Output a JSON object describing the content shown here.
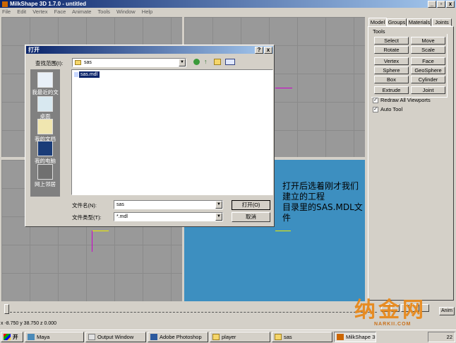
{
  "app": {
    "title": "MilkShape 3D 1.7.0 - untitled",
    "menu": [
      "File",
      "Edit",
      "Vertex",
      "Face",
      "Animate",
      "Tools",
      "Window",
      "Help"
    ],
    "win_buttons": [
      "_",
      "▫",
      "x"
    ]
  },
  "panel": {
    "tabs": [
      "Model",
      "Groups",
      "Materials",
      "Joints"
    ],
    "tools_label": "Tools",
    "tools": [
      "Select",
      "Move",
      "Rotate",
      "Scale",
      "Vertex",
      "Face",
      "Sphere",
      "GeoSphere",
      "Box",
      "Cylinder",
      "Extrude",
      "Joint"
    ],
    "checks": [
      {
        "label": "Redraw All Viewports",
        "checked": true
      },
      {
        "label": "Auto Tool",
        "checked": true
      }
    ]
  },
  "dialog": {
    "title": "打开",
    "lookin_label": "查找范围(I):",
    "lookin_value": "sas",
    "places": [
      "我最近的文档",
      "桌面",
      "我的文档",
      "我的电脑",
      "网上邻居"
    ],
    "files": [
      "sas.mdl"
    ],
    "filename_label": "文件名(N):",
    "filename_value": "sas",
    "filetype_label": "文件类型(T):",
    "filetype_value": "*.mdl",
    "open_label": "打开(O)",
    "cancel_label": "取消",
    "help_btn": "?",
    "close_btn": "x"
  },
  "annotation": {
    "line1": "打开后选着刚才我们建立的工程",
    "line2": "目录里的SAS.MDL文件"
  },
  "timeline": {
    "anim_label": "Anim"
  },
  "status": {
    "coords": "x -8.750 y 38.750 z 0.000"
  },
  "taskbar": {
    "start": "开始",
    "tasks": [
      "Maya",
      "Output Window",
      "Adobe Photoshop",
      "player",
      "sas",
      "MilkShape 3D..."
    ],
    "clock": "22"
  },
  "watermark": {
    "text": "纳金网",
    "url": "NARKII.COM"
  },
  "colors": {
    "title": "#0a246a",
    "viewport3d": "#3d8fc0",
    "desktop_face": "#d4d0c8"
  }
}
